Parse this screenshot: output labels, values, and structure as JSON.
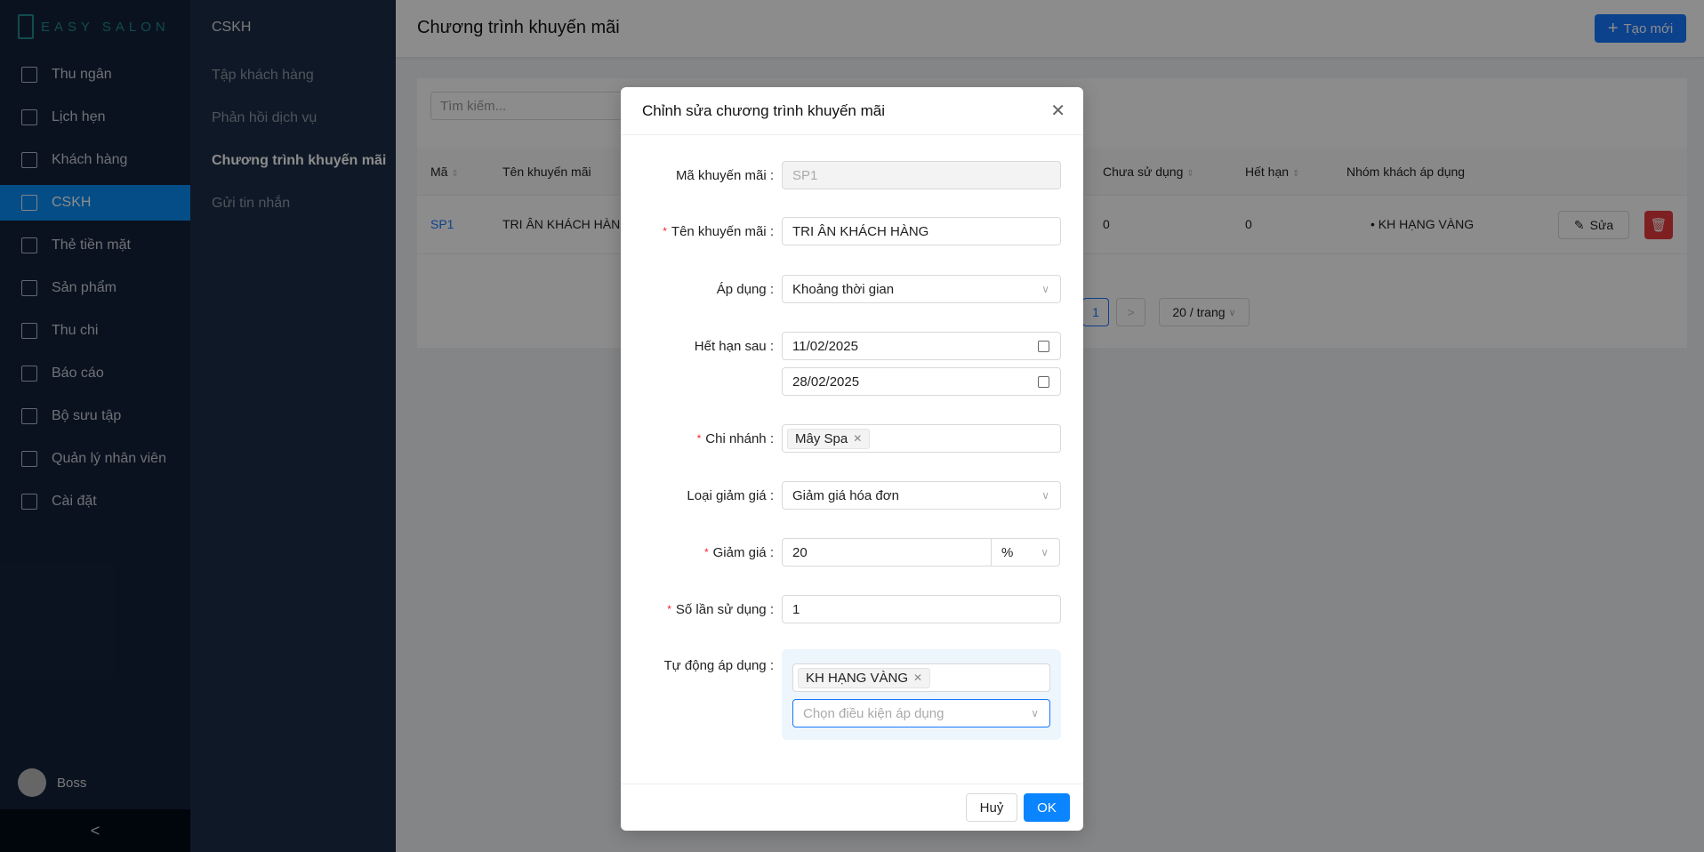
{
  "brand": "EASY SALON",
  "sidebar": {
    "items": [
      {
        "label": "Thu ngân",
        "icon": "wallet-icon"
      },
      {
        "label": "Lịch hẹn",
        "icon": "calendar-icon"
      },
      {
        "label": "Khách hàng",
        "icon": "user-icon"
      },
      {
        "label": "CSKH",
        "icon": "customer-care-icon",
        "active": true
      },
      {
        "label": "Thẻ tiền mặt",
        "icon": "card-icon"
      },
      {
        "label": "Sản phẩm",
        "icon": "box-icon"
      },
      {
        "label": "Thu chi",
        "icon": "book-icon"
      },
      {
        "label": "Báo cáo",
        "icon": "chart-icon"
      },
      {
        "label": "Bộ sưu tập",
        "icon": "image-icon"
      },
      {
        "label": "Quản lý nhân viên",
        "icon": "staff-icon"
      },
      {
        "label": "Cài đặt",
        "icon": "gear-icon"
      }
    ],
    "user": "Boss",
    "collapse": "<"
  },
  "submenu": {
    "title": "CSKH",
    "items": [
      "Tập khách hàng",
      "Phản hồi dịch vụ",
      "Chương trình khuyến mãi",
      "Gửi tin nhắn"
    ],
    "active": 2
  },
  "header": {
    "title": "Chương trình khuyến mãi",
    "create": "Tạo mới"
  },
  "search": {
    "placeholder": "Tìm kiếm..."
  },
  "table": {
    "columns": [
      "Mã",
      "Tên khuyến mãi",
      "Chưa sử dụng",
      "Hết hạn",
      "Nhóm khách áp dụng"
    ],
    "rows": [
      {
        "code": "SP1",
        "name": "TRI ÂN KHÁCH HÀNG",
        "unused": "0",
        "expired": "0",
        "group": "KH HẠNG VÀNG"
      }
    ],
    "edit": "Sửa"
  },
  "pagination": {
    "page": "1",
    "next": ">",
    "size": "20 / trang"
  },
  "modal": {
    "title": "Chỉnh sửa chương trình khuyến mãi",
    "fields": {
      "code": {
        "label": "Mã khuyến mãi",
        "value": "SP1"
      },
      "name": {
        "label": "Tên khuyến mãi",
        "value": "TRI ÂN KHÁCH HÀNG"
      },
      "apply": {
        "label": "Áp dụng",
        "value": "Khoảng thời gian"
      },
      "expire": {
        "label": "Hết hạn sau",
        "from": "11/02/2025",
        "to": "28/02/2025"
      },
      "branch": {
        "label": "Chi nhánh",
        "tag": "Mây Spa"
      },
      "discount_type": {
        "label": "Loại giảm giá",
        "value": "Giảm giá hóa đơn"
      },
      "discount": {
        "label": "Giảm giá",
        "value": "20",
        "unit": "%"
      },
      "uses": {
        "label": "Số lần sử dụng",
        "value": "1"
      },
      "auto": {
        "label": "Tự động áp dụng",
        "tag": "KH HẠNG VÀNG",
        "placeholder": "Chọn điều kiện áp dụng"
      }
    },
    "cancel": "Huỷ",
    "ok": "OK"
  }
}
